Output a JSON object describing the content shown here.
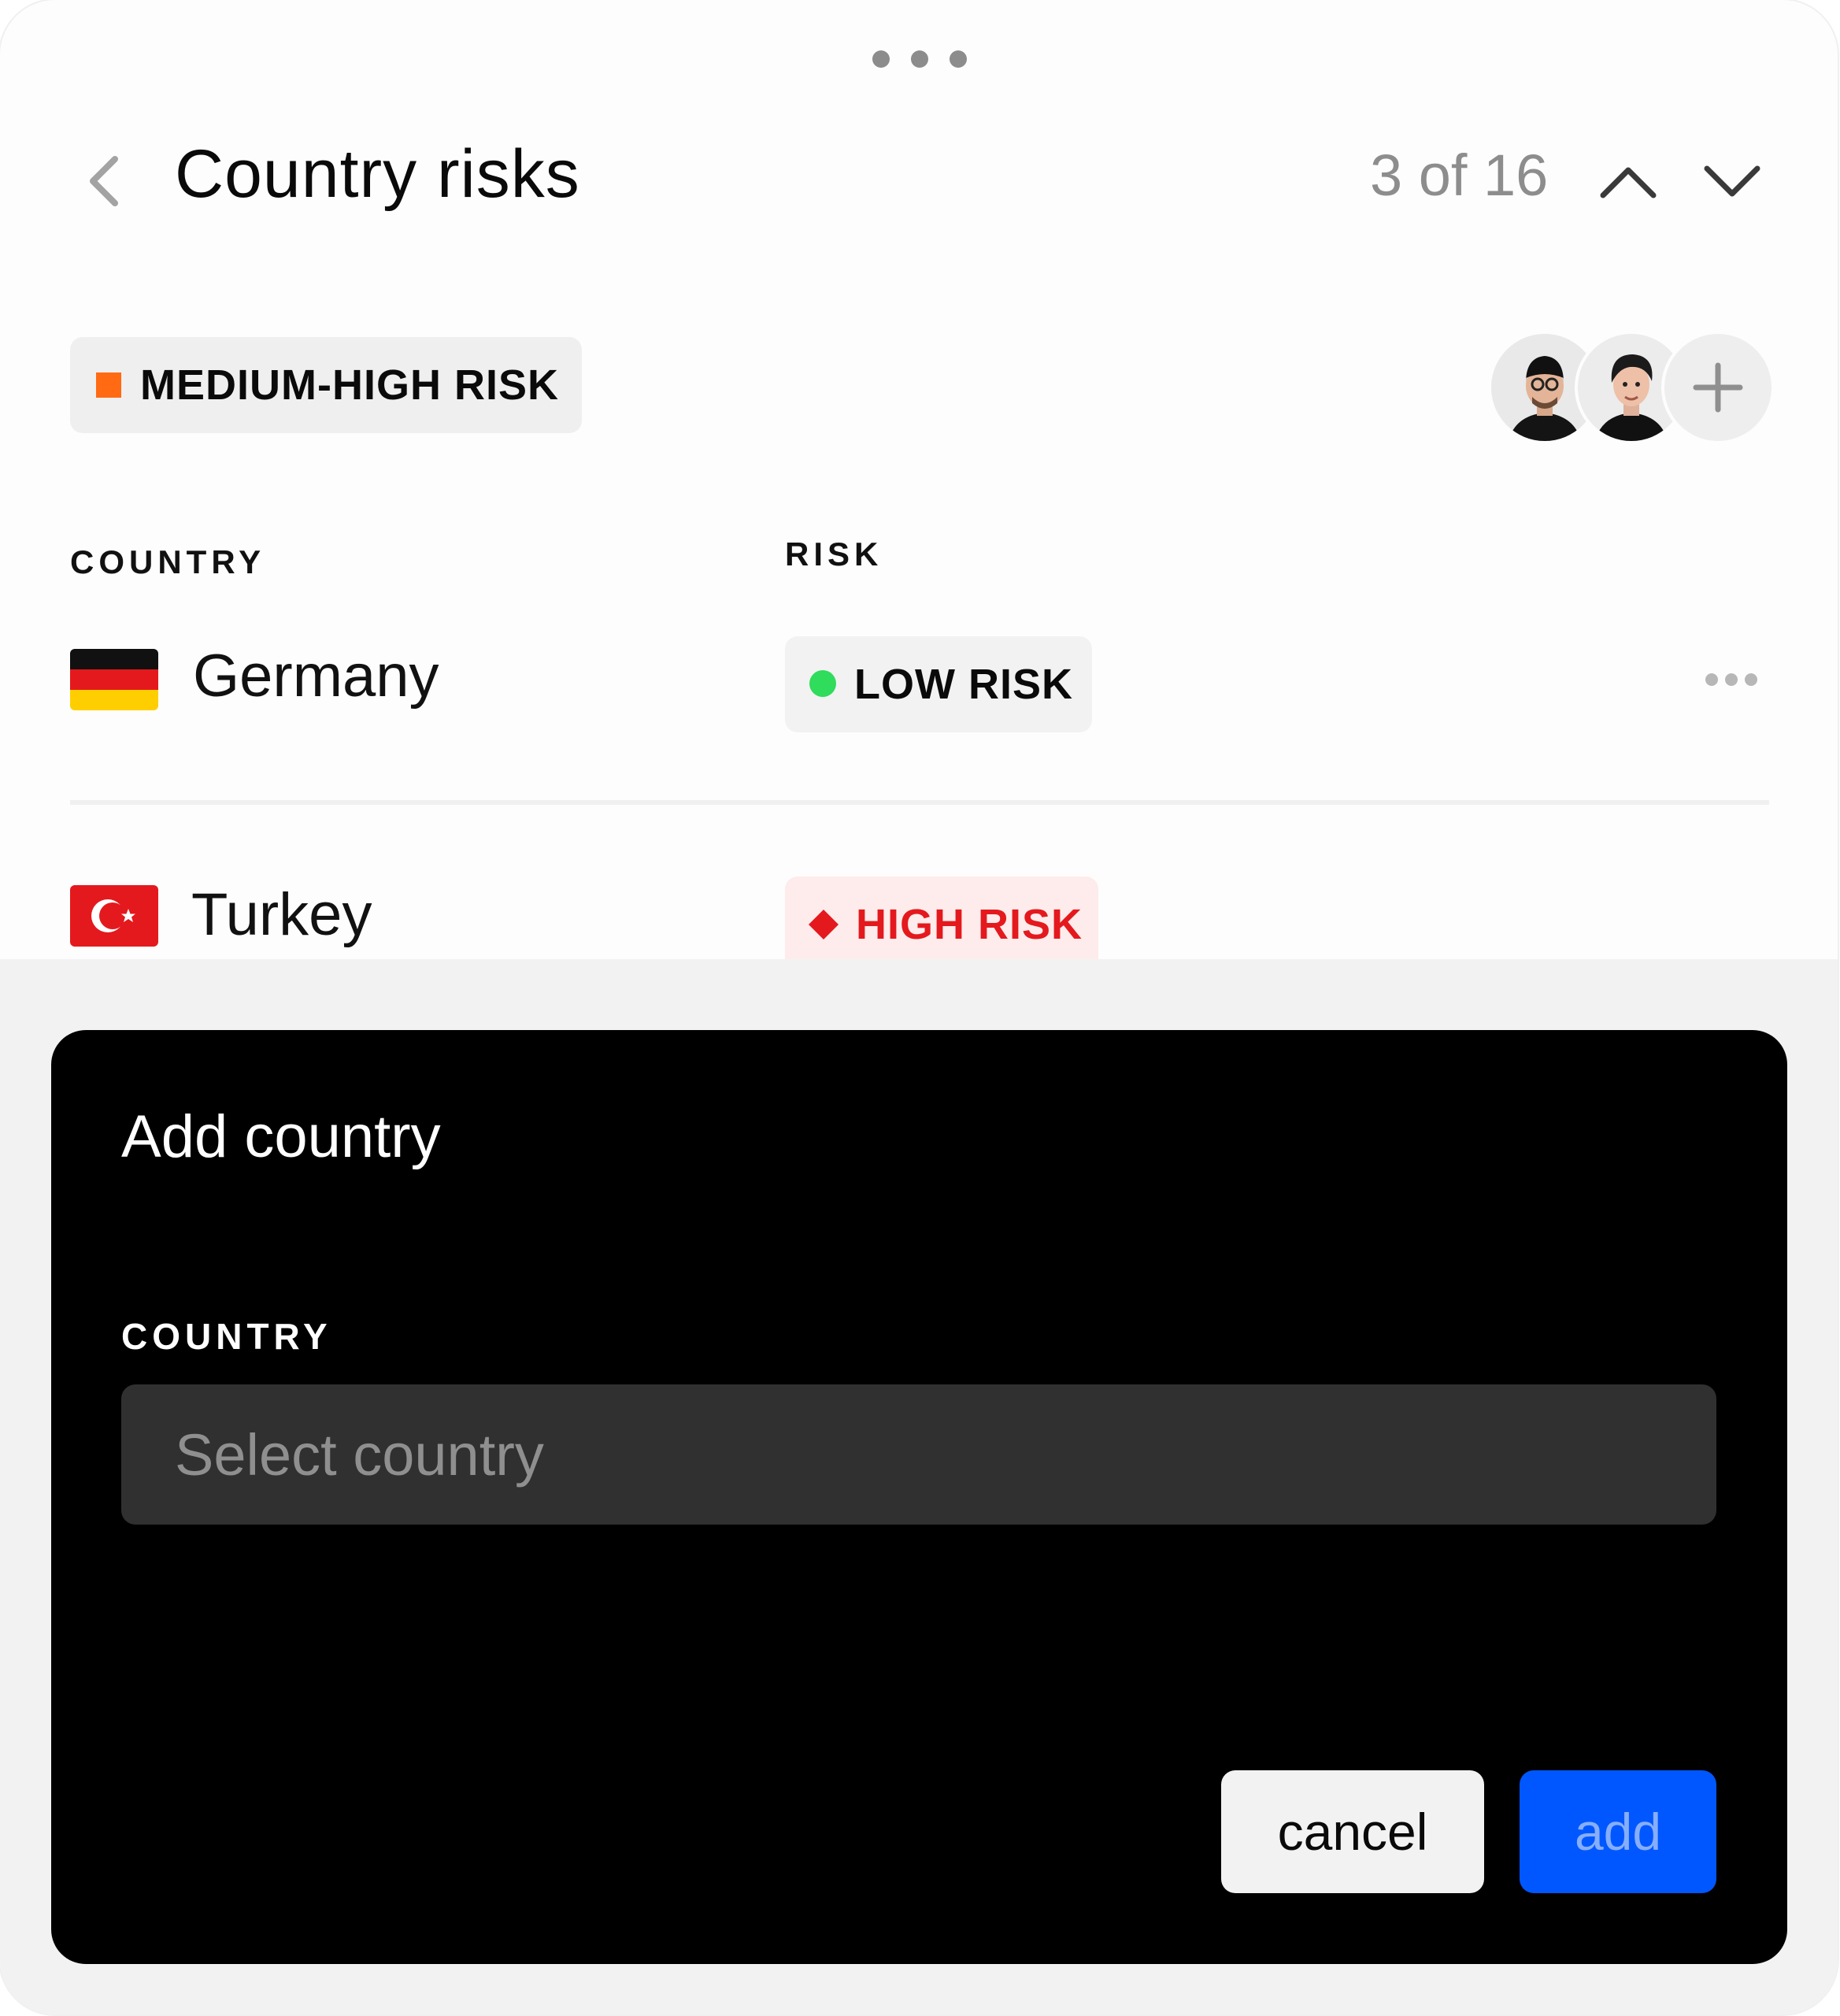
{
  "header": {
    "title": "Country risks",
    "pager": "3 of 16"
  },
  "overall_risk": {
    "label": "MEDIUM-HIGH RISK",
    "color": "#ff6a13"
  },
  "table": {
    "columns": [
      "COUNTRY",
      "RISK"
    ],
    "rows": [
      {
        "country": "Germany",
        "flag": "germany-flag",
        "risk": "LOW RISK",
        "risk_color": "#2fdc5b"
      },
      {
        "country": "Turkey",
        "flag": "turkey-flag",
        "risk": "HIGH RISK",
        "risk_color": "#e4191e"
      }
    ]
  },
  "modal": {
    "title": "Add country",
    "field_label": "COUNTRY",
    "placeholder": "Select country",
    "cancel_label": "cancel",
    "add_label": "add"
  },
  "colors": {
    "primary": "#0057ff",
    "low_risk_bg": "#f2f2f2",
    "high_risk_bg": "#fdeceb"
  }
}
